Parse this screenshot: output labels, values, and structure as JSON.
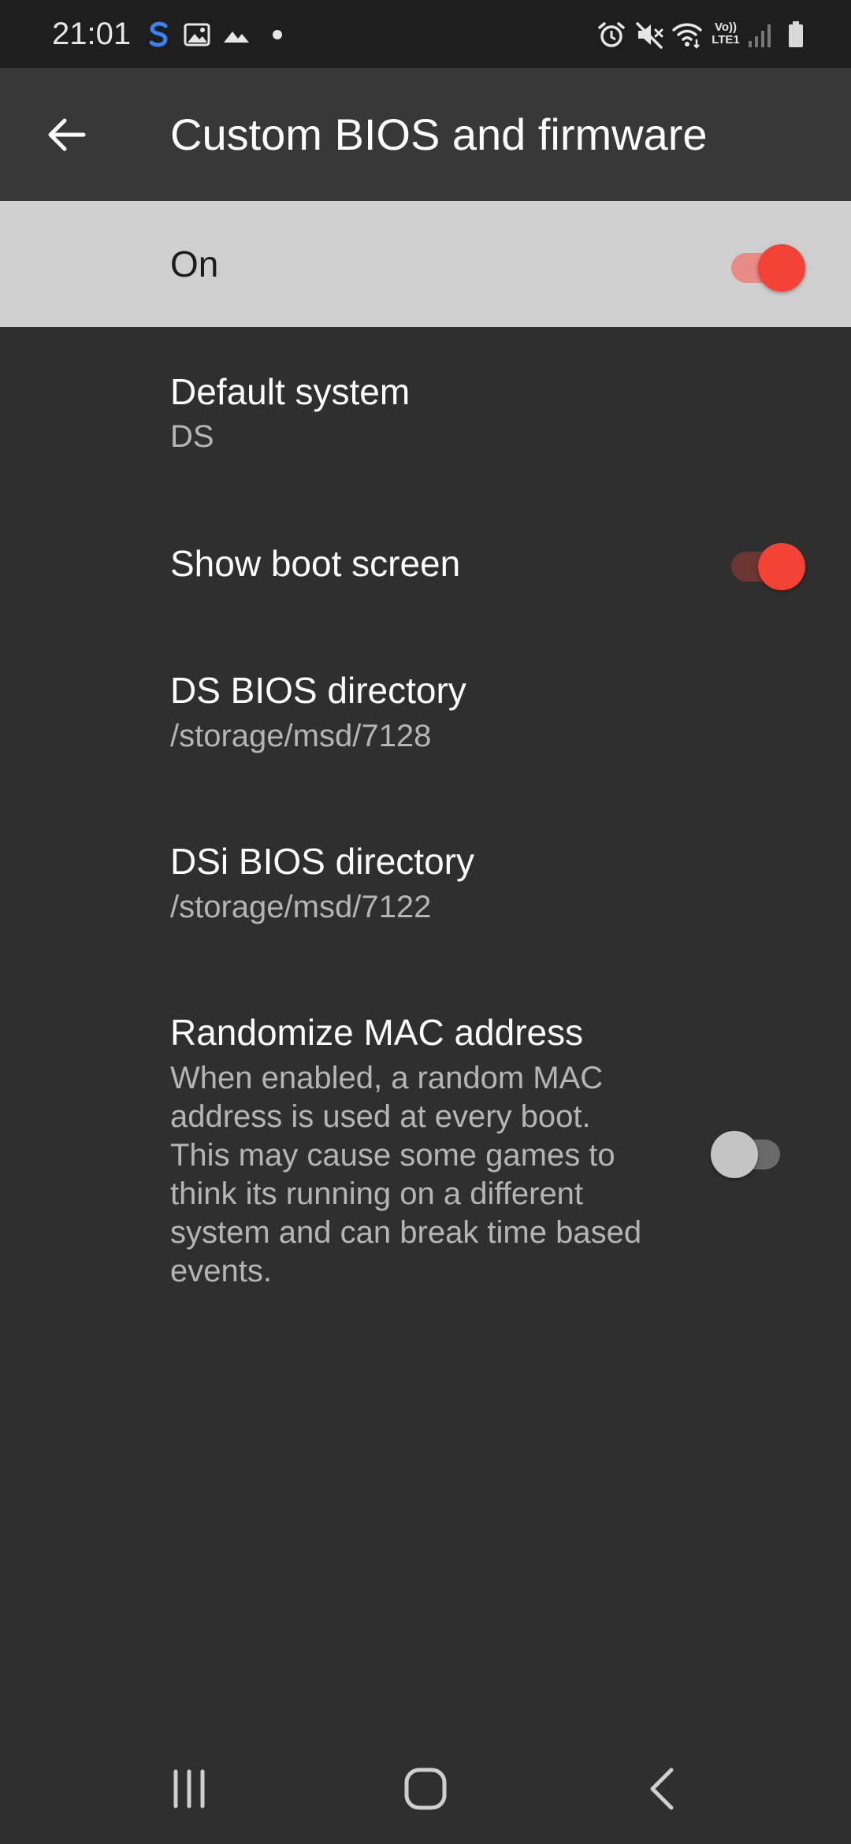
{
  "status_bar": {
    "time": "21:01",
    "left_icons": [
      "samsung-s-icon",
      "gallery-icon",
      "mountain-icon",
      "dot-icon"
    ],
    "right_icons": [
      "alarm-icon",
      "mute-icon",
      "wifi-icon",
      "volte-lte-icon",
      "signal-icon",
      "battery-icon"
    ],
    "network_label_top": "Vo))",
    "network_label_bottom": "LTE1",
    "accent_icon_color": "#3b82f6"
  },
  "app_bar": {
    "title": "Custom BIOS and firmware",
    "back_icon": "arrow-back-icon"
  },
  "master_switch": {
    "label": "On",
    "checked": true
  },
  "preferences": [
    {
      "id": "default-system",
      "title": "Default system",
      "summary": "DS"
    },
    {
      "id": "show-boot-screen",
      "title": "Show boot screen",
      "checked": true
    },
    {
      "id": "ds-bios-directory",
      "title": "DS BIOS directory",
      "summary": "/storage/msd/7128"
    },
    {
      "id": "dsi-bios-directory",
      "title": "DSi BIOS directory",
      "summary": "/storage/msd/7122"
    },
    {
      "id": "randomize-mac",
      "title": "Randomize MAC address",
      "summary_lines": [
        "When enabled, a random MAC",
        "address is used at every boot.",
        "This may cause some games to",
        "think its running on a different",
        "system and can break time based",
        "events."
      ],
      "checked": false
    }
  ],
  "nav_bar": {
    "icons": [
      "recent-apps-icon",
      "home-icon",
      "back-nav-icon"
    ]
  },
  "colors": {
    "accent": "#f44336",
    "background": "#2f2f2f",
    "app_bar": "#383838",
    "master_bar": "#cfcfcf"
  }
}
